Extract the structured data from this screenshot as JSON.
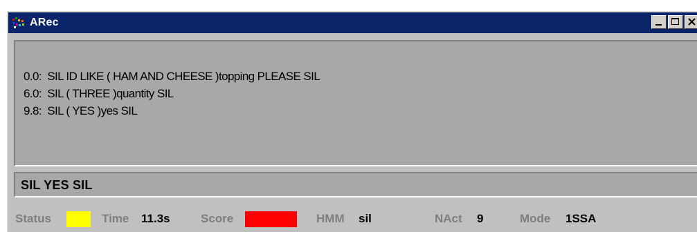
{
  "window": {
    "title": "ARec",
    "icon": "app-icon",
    "controls": [
      "minimize-icon",
      "maximize-icon",
      "close-icon"
    ]
  },
  "transcript": {
    "lines": [
      "0.0:  SIL ID LIKE ( HAM AND CHEESE )topping PLEASE SIL",
      "6.0:  SIL ( THREE )quantity SIL",
      "9.8:  SIL ( YES )yes SIL"
    ]
  },
  "result": {
    "text": "SIL YES SIL"
  },
  "status": {
    "status_label": "Status",
    "status_color": "#ffff00",
    "time_label": "Time",
    "time_value": "11.3s",
    "score_label": "Score",
    "score_color": "#ff0000",
    "hmm_label": "HMM",
    "hmm_value": "sil",
    "nact_label": "NAct",
    "nact_value": "9",
    "mode_label": "Mode",
    "mode_value": "1SSA"
  },
  "colors": {
    "titlebar": "#0a246a",
    "panel": "#a8a8a8",
    "window": "#c0c0c0"
  }
}
